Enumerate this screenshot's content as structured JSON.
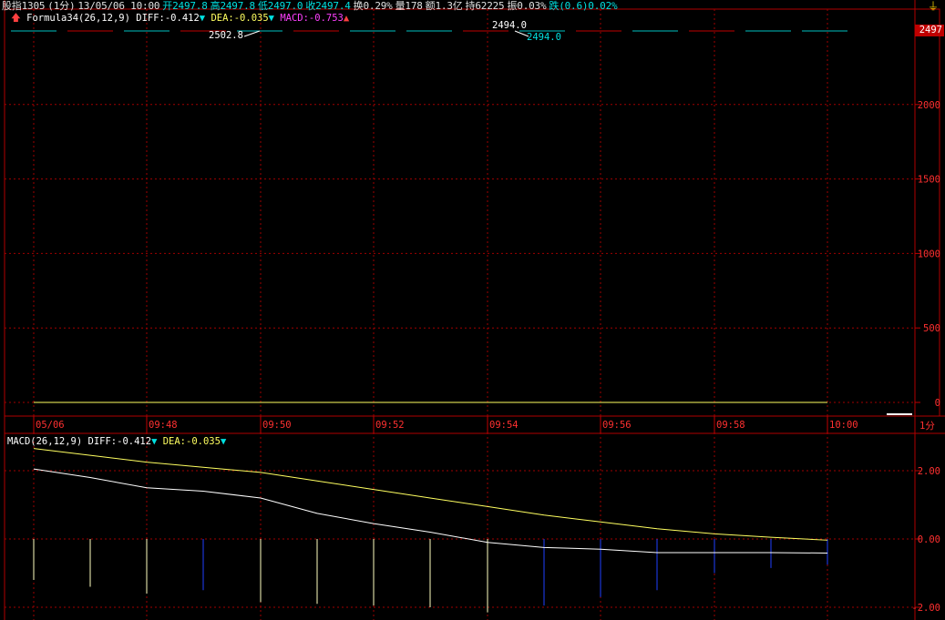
{
  "header": {
    "symbol": "股指1305",
    "period": "(1分)",
    "datetime": "13/05/06 10:00",
    "open": "开2497.8",
    "high": "高2497.8",
    "low": "低2497.0",
    "close": "收2497.4",
    "change_pct": "换0.29%",
    "volume": "量178",
    "amount": "额1.3亿",
    "hold": "持62225",
    "amplitude": "振0.03%",
    "fall": "跌(0.6)0.02%"
  },
  "formula_line": {
    "name": "Formula34(26,12,9)",
    "diff": "DIFF:-0.412",
    "dea": "DEA:-0.035",
    "macd": "MACD:-0.753"
  },
  "macd_line": {
    "name": "MACD(26,12,9)",
    "diff": "DIFF:-0.412",
    "dea": "DEA:-0.035"
  },
  "price_annotations": {
    "high_label": "2502.8",
    "mid_label": "2494.0",
    "mid_label2": "2494.0",
    "current_price_tag": "2497"
  },
  "time_axis": {
    "labels": [
      "05/06",
      "09:48",
      "09:50",
      "09:52",
      "09:54",
      "09:56",
      "09:58",
      "10:00"
    ],
    "period_label": "1分"
  },
  "chart_data": [
    {
      "type": "line",
      "title": "Formula34(26,12,9)",
      "y_ticks": [
        0,
        500,
        1000,
        1500,
        2000
      ],
      "ylim": [
        0,
        2497
      ],
      "grid": true,
      "series": [
        {
          "name": "DEA",
          "values": [
            0,
            0,
            0,
            0,
            0,
            0,
            0,
            0,
            0,
            0,
            0,
            0,
            0,
            0,
            0
          ]
        }
      ]
    },
    {
      "type": "line",
      "title": "MACD(26,12,9)",
      "y_ticks": [
        "2.00",
        "0.00",
        "-2.00"
      ],
      "ylim": [
        -2.0,
        2.0
      ],
      "grid": true,
      "x": [
        0,
        1,
        2,
        3,
        4,
        5,
        6,
        7,
        8,
        9,
        10,
        11,
        12,
        13,
        14
      ],
      "series": [
        {
          "name": "DEA",
          "values": [
            2.65,
            2.45,
            2.25,
            2.1,
            1.95,
            1.7,
            1.45,
            1.2,
            0.95,
            0.7,
            0.5,
            0.3,
            0.15,
            0.05,
            -0.035
          ]
        },
        {
          "name": "DIFF",
          "values": [
            2.05,
            1.8,
            1.5,
            1.4,
            1.2,
            0.75,
            0.45,
            0.2,
            -0.1,
            -0.25,
            -0.3,
            -0.4,
            -0.4,
            -0.4,
            -0.412
          ]
        },
        {
          "name": "MACD",
          "values": [
            -1.2,
            -1.4,
            -1.6,
            -1.5,
            -1.85,
            -1.9,
            -1.95,
            -2.0,
            -2.15,
            -1.95,
            -1.7,
            -1.5,
            -1.0,
            -0.85,
            -0.753
          ]
        }
      ],
      "bar_colors_note": "light yellow/white for early bars, blue for later bars",
      "colors": {
        "dea": "#ffff60",
        "diff": "#ffffff",
        "macd_pos": "#ffffd0",
        "macd_neg": "#2040ff"
      }
    }
  ],
  "colors": {
    "background": "#000000",
    "grid": "#800000",
    "axis": "#c00000",
    "label": "#ff3030"
  }
}
